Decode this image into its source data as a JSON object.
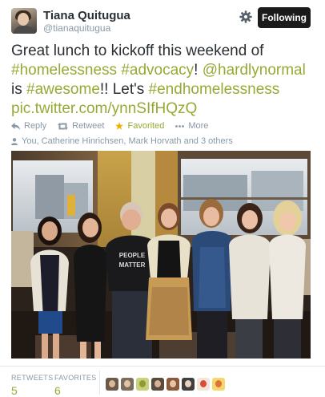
{
  "user": {
    "name": "Tiana Quitugua",
    "handle": "@tianaquitugua"
  },
  "follow_button": "Following",
  "tweet": {
    "segments": [
      {
        "text": "Great lunch to kickoff this weekend of ",
        "link": false
      },
      {
        "text": "#homelessness",
        "link": true
      },
      {
        "text": " ",
        "link": false
      },
      {
        "text": "#advocacy",
        "link": true
      },
      {
        "text": "! ",
        "link": false
      },
      {
        "text": "@hardlynormal",
        "link": true
      },
      {
        "text": " is ",
        "link": false
      },
      {
        "text": "#awesome",
        "link": true
      },
      {
        "text": "!! Let's ",
        "link": false
      },
      {
        "text": "#endhomelessness",
        "link": true
      },
      {
        "text": " ",
        "link": false
      },
      {
        "text": "pic.twitter.com/ynnSIfHQzQ",
        "link": true
      }
    ]
  },
  "actions": {
    "reply": "Reply",
    "retweet": "Retweet",
    "favorite": "Favorited",
    "more": "More"
  },
  "favorited_by": "You, Catherine Hinrichsen, Mark Horvath and 3 others",
  "stats": {
    "retweets_label": "RETWEETS",
    "retweets": "5",
    "favorites_label": "FAVORITES",
    "favorites": "6"
  },
  "favoriter_avatars": [
    {
      "icon": "avatar-1",
      "bg": "#6b5a4a",
      "face": "#d9b99a"
    },
    {
      "icon": "avatar-2",
      "bg": "#7d6b5c",
      "face": "#e0c4a8"
    },
    {
      "icon": "avatar-3",
      "bg": "#c9d27a",
      "face": "#8f9a3a"
    },
    {
      "icon": "avatar-4",
      "bg": "#5a4b3f",
      "face": "#d8b295"
    },
    {
      "icon": "avatar-5",
      "bg": "#8b5a3c",
      "face": "#e6c5a6"
    },
    {
      "icon": "avatar-6",
      "bg": "#3f3f3f",
      "face": "#e8d3bf"
    },
    {
      "icon": "avatar-7",
      "bg": "#f2e6d8",
      "face": "#d94b3b"
    },
    {
      "icon": "avatar-8",
      "bg": "#f5d76e",
      "face": "#e0703a"
    }
  ],
  "colors": {
    "link": "#96aa33",
    "muted": "#8899a6",
    "button": "#1b1b1b"
  }
}
